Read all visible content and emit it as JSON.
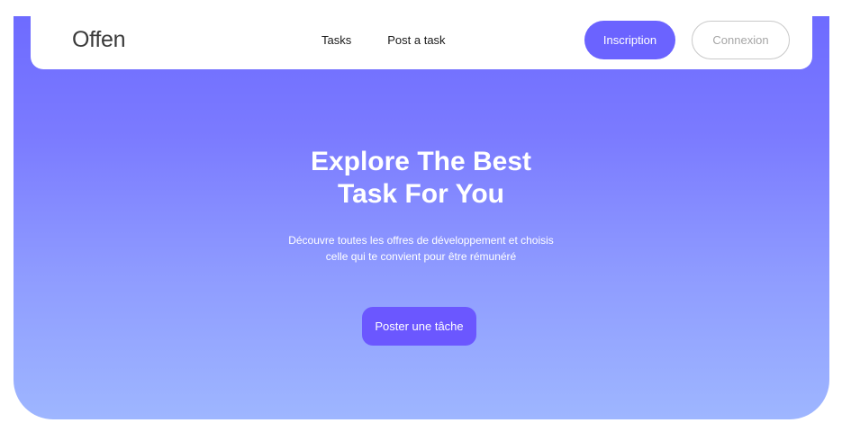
{
  "brand": {
    "logo": "Offen"
  },
  "nav": {
    "links": [
      "Tasks",
      "Post a task"
    ],
    "signup_label": "Inscription",
    "login_label": "Connexion"
  },
  "hero": {
    "title_line1": "Explore The Best",
    "title_line2": "Task For You",
    "subtitle_line1": "Découvre toutes les offres de développement et choisis",
    "subtitle_line2": "celle qui te convient pour être rémunéré",
    "cta_label": "Poster une tâche"
  },
  "colors": {
    "accent": "#6b63ff",
    "gradient_top": "#6e6bff",
    "gradient_bottom": "#9eb6ff",
    "navbar_bg": "#ffffff"
  }
}
